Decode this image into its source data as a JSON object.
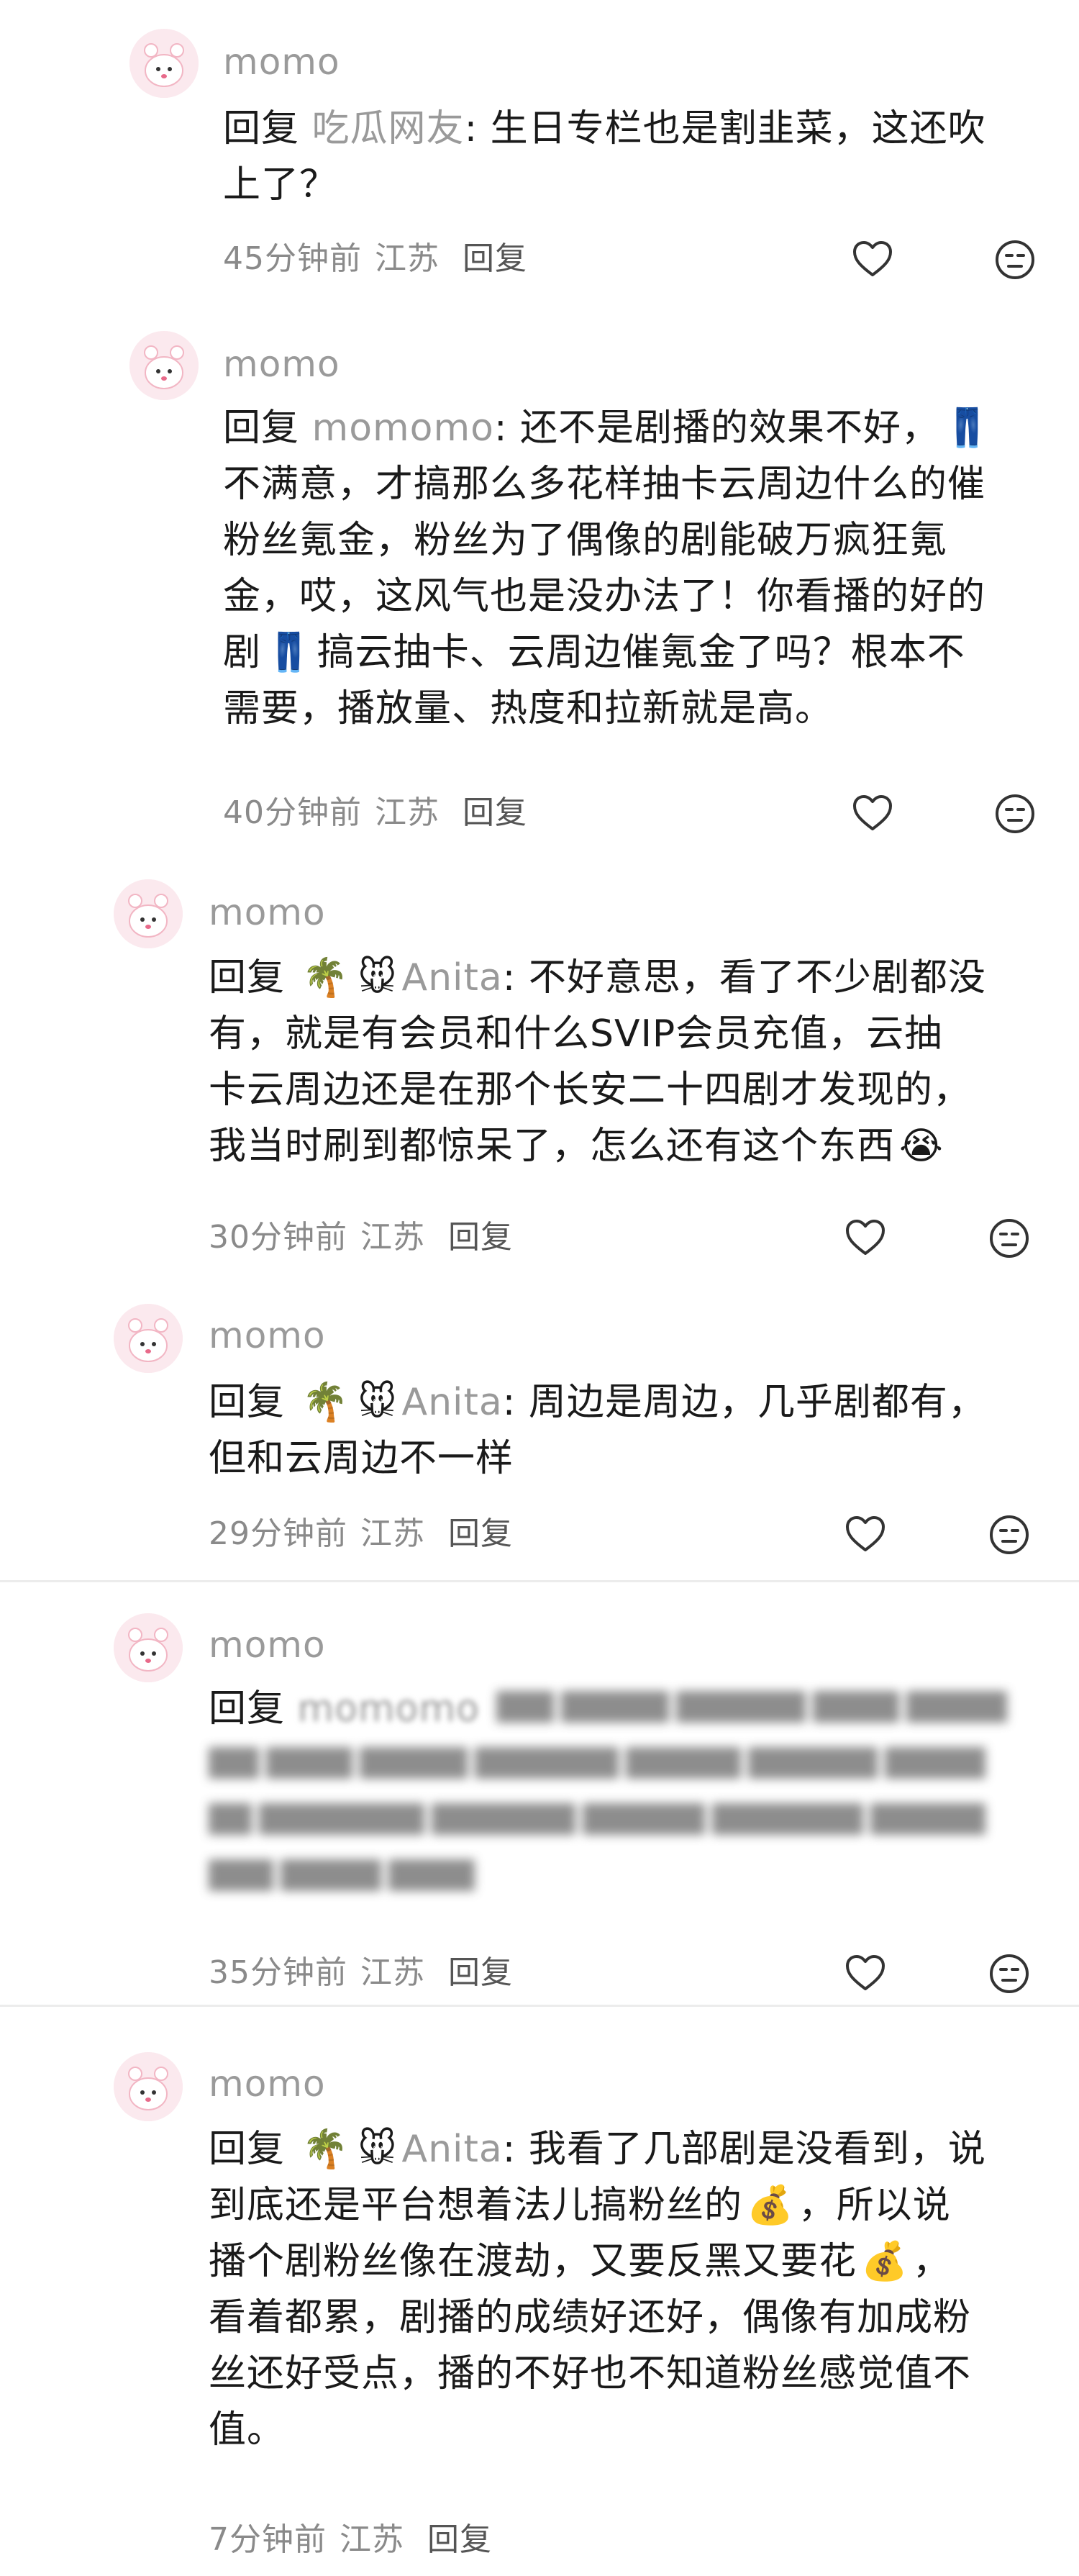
{
  "comments": [
    {
      "username": "momo",
      "reply_word": "回复",
      "reply_target": "吃瓜网友",
      "lines": [
        "生日专栏也是割韭菜，这还吹",
        "上了？"
      ],
      "time": "45分钟前",
      "location": "江苏",
      "reply_btn": "回复"
    },
    {
      "username": "momo",
      "reply_word": "回复",
      "reply_target": "momomo",
      "lines": [
        "还不是剧播的效果不好，",
        "不满意，才搞那么多花样抽卡云周边什么的催",
        "粉丝氪金，粉丝为了偶像的剧能破万疯狂氪",
        "金，哎，这风气也是没办法了！你看播的好的",
        "搞云抽卡、云周边催氪金了吗？根本不",
        "需要，播放量、热度和拉新就是高。"
      ],
      "time": "40分钟前",
      "location": "江苏",
      "reply_btn": "回复"
    },
    {
      "username": "momo",
      "reply_word": "回复",
      "reply_target": "Anita",
      "lines": [
        "不好意思，看了不少剧都没",
        "有，就是有会员和什么SVIP会员充值，云抽",
        "卡云周边还是在那个长安二十四剧才发现的，",
        "我当时刷到都惊呆了，怎么还有这个东西"
      ],
      "time": "30分钟前",
      "location": "江苏",
      "reply_btn": "回复"
    },
    {
      "username": "momo",
      "reply_word": "回复",
      "reply_target": "Anita",
      "lines": [
        "周边是周边，几乎剧都有，",
        "但和云周边不一样"
      ],
      "time": "29分钟前",
      "location": "江苏",
      "reply_btn": "回复"
    },
    {
      "username": "momo",
      "reply_word": "回复",
      "reply_target": "momomo",
      "time": "35分钟前",
      "location": "江苏",
      "reply_btn": "回复"
    },
    {
      "username": "momo",
      "reply_word": "回复",
      "reply_target": "Anita",
      "lines": [
        "我看了几部剧是没看到，说",
        "到底还是平台想着法儿搞粉丝的",
        "，所以说",
        "播个剧粉丝像在渡劫，又要反黑又要花",
        "，",
        "看着都累，剧播的成绩好还好，偶像有加成粉",
        "丝还好受点，播的不好也不知道粉丝感觉值不",
        "值。"
      ],
      "time": "7分钟前",
      "location": "江苏",
      "reply_btn": "回复"
    }
  ],
  "icons": {
    "palm": "🌴",
    "mouse": "🐭",
    "jeans": "👖",
    "cry": "😭",
    "money_bag": "💰"
  },
  "colors": {
    "text": "#1a1a1a",
    "meta": "#8a8a8a",
    "username": "#9a9a9a",
    "avatar_bg": "#fbe9ee"
  }
}
